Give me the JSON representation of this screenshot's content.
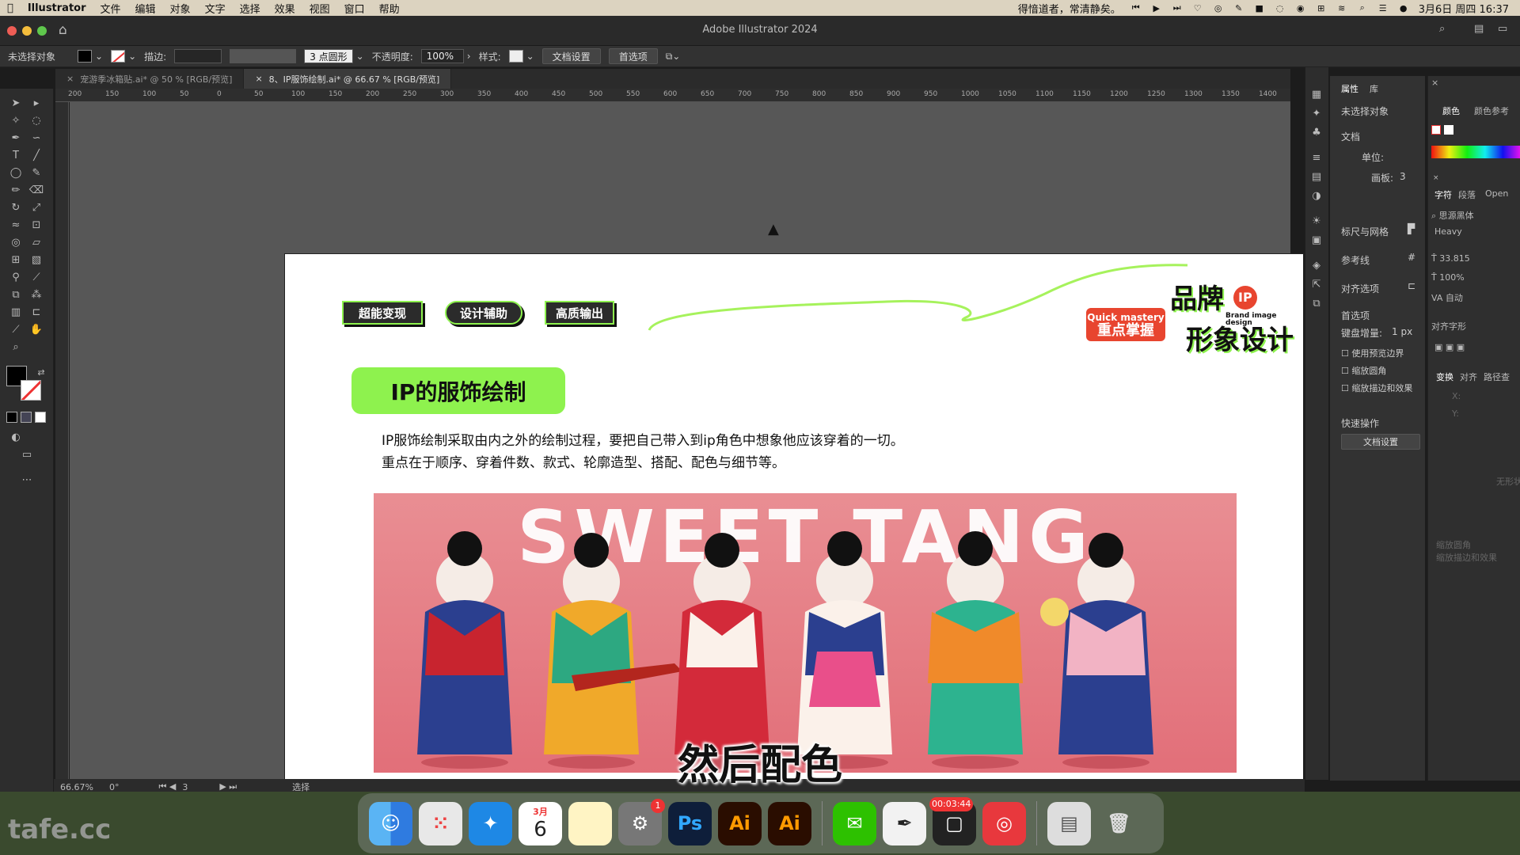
{
  "menubar": {
    "app_name": "Illustrator",
    "items": [
      "文件",
      "编辑",
      "对象",
      "文字",
      "选择",
      "效果",
      "视图",
      "窗口",
      "帮助"
    ],
    "status_text": "得愔道者，常清静矣。",
    "datetime": "3月6日 周四  16:37"
  },
  "window": {
    "title": "Adobe Illustrator 2024"
  },
  "controlbar": {
    "selection": "未选择对象",
    "stroke_label": "描边:",
    "brush_label": "3 点圆形",
    "opacity_label": "不透明度:",
    "opacity_value": "100%",
    "style_label": "样式:",
    "doc_settings": "文档设置",
    "preferences": "首选项"
  },
  "tabs": [
    {
      "label": "宠游季冰箱贴.ai* @ 50 % [RGB/预览]"
    },
    {
      "label": "8、IP服饰绘制.ai* @ 66.67 % [RGB/预览]"
    }
  ],
  "ruler_ticks": [
    "200",
    "150",
    "100",
    "50",
    "0",
    "50",
    "100",
    "150",
    "200",
    "250",
    "300",
    "350",
    "400",
    "450",
    "500",
    "550",
    "600",
    "650",
    "700",
    "750",
    "800",
    "850",
    "900",
    "950",
    "1000",
    "1050",
    "1100",
    "1150",
    "1200",
    "1250",
    "1300",
    "1350",
    "1400"
  ],
  "artboard": {
    "tags": [
      "超能变现",
      "设计辅助",
      "高质输出"
    ],
    "title": "IP的服饰绘制",
    "body_line1": "IP服饰绘制采取由内之外的绘制过程，要把自己带入到ip角色中想象他应该穿着的一切。",
    "body_line2": "重点在于顺序、穿着件数、款式、轮廓造型、搭配、配色与细节等。",
    "photo_text": "SWEET TANG",
    "quick_en": "Quick mastery",
    "quick_cn": "重点掌握",
    "brand_line1": "品牌",
    "brand_ip": "IP",
    "brand_line2": "形象设计",
    "brand_small": "Brand image design"
  },
  "properties": {
    "tab_props": "属性",
    "tab_lib": "库",
    "no_selection": "未选择对象",
    "document": "文档",
    "unit_label": "单位:",
    "artboard_label": "画板:",
    "artboard_value": "3",
    "rulers_grid": "标尺与网格",
    "guides": "参考线",
    "align": "对齐选项",
    "prefs": "首选项",
    "keyboard_inc_label": "键盘增量:",
    "keyboard_inc_value": "1 px",
    "chk_preview": "使用预览边界",
    "chk_corners": "缩放圆角",
    "chk_strokes": "缩放描边和效果",
    "quick_actions": "快速操作",
    "doc_settings_btn": "文档设置"
  },
  "charpanel": {
    "tab_color": "颜色",
    "tab_color_ref": "颜色参考",
    "tab_char": "字符",
    "tab_para": "段落",
    "tab_open": "Open",
    "font_family": "思源黑体",
    "font_style": "Heavy",
    "font_size": "33.815",
    "leading": "100%",
    "tracking": "自动",
    "glyphs_label": "对齐字形",
    "tab_transform": "变换",
    "tab_align": "对齐",
    "tab_path": "路径查",
    "x_label": "X:",
    "y_label": "Y:",
    "no_shape": "无形状",
    "faded_corners": "缩放圆角",
    "faded_strokes": "缩放描边和效果"
  },
  "statusbar": {
    "zoom": "66.67%",
    "rotation": "0°",
    "artboard_num": "3",
    "mode": "选择"
  },
  "subtitle": "然后配色",
  "dock": {
    "calendar_month": "3月",
    "calendar_day": "6",
    "settings_badge": "1",
    "ps_label": "Ps",
    "ai_label": "Ai",
    "ai2_label": "Ai",
    "recorder_time": "00:03:44"
  },
  "watermark": "tafe.cc",
  "colors": {
    "accent_green": "#8ef24e",
    "canvas": "#575757",
    "quick_red": "#e8452f"
  }
}
